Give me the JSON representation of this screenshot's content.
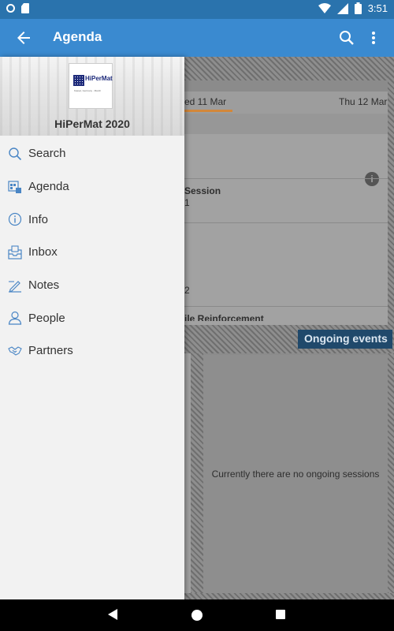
{
  "status_bar": {
    "time": "3:51",
    "icons": [
      "circle-icon",
      "sd-card-icon",
      "wifi-icon",
      "signal-icon",
      "battery-icon"
    ]
  },
  "app_bar": {
    "title": "Agenda",
    "back_icon": "arrow-back-icon",
    "search_icon": "search-icon",
    "more_icon": "more-vert-icon"
  },
  "drawer": {
    "logo_text": "HiPerMat",
    "logo_subtext": "Kassel, Germany · March",
    "event_title": "HiPerMat 2020",
    "items": [
      {
        "label": "Search",
        "icon": "search-icon"
      },
      {
        "label": "Agenda",
        "icon": "agenda-icon"
      },
      {
        "label": "Info",
        "icon": "info-icon"
      },
      {
        "label": "Inbox",
        "icon": "inbox-icon"
      },
      {
        "label": "Notes",
        "icon": "notes-icon"
      },
      {
        "label": "People",
        "icon": "people-icon"
      },
      {
        "label": "Partners",
        "icon": "partners-icon"
      }
    ]
  },
  "background": {
    "day_tab_1": "ed 11 Mar",
    "day_tab_2": "Thu 12 Mar",
    "session_fragment": "Session",
    "session_fragment_2": "1",
    "session_fragment_3": "2",
    "session_fragment_4": "ile Reinforcement",
    "ongoing_label": "Ongoing events",
    "no_ongoing_text": "Currently there are no ongoing sessions"
  },
  "colors": {
    "status_bar": "#2a73ad",
    "app_bar": "#3a8ad0",
    "drawer_bg": "#f2f2f2",
    "accent_underline": "#d3873a",
    "ongoing_label_bg": "#20496b"
  }
}
